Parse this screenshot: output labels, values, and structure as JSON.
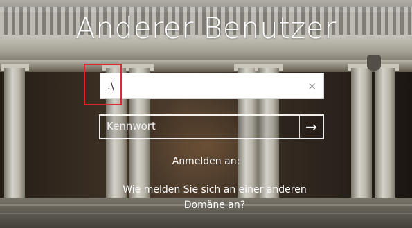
{
  "login": {
    "title": "Anderer Benutzer",
    "username_value": ".\\",
    "clear_glyph": "×",
    "password_placeholder": "Kennwort",
    "submit_glyph": "→",
    "signin_to_label": "Anmelden an:",
    "other_domain_link": "Wie melden Sie sich an einer anderen Domäne an?"
  },
  "icons": {
    "clear": "close-icon",
    "submit": "arrow-right-icon"
  },
  "colors": {
    "highlight": "#e0272a",
    "text": "#ffffff"
  }
}
